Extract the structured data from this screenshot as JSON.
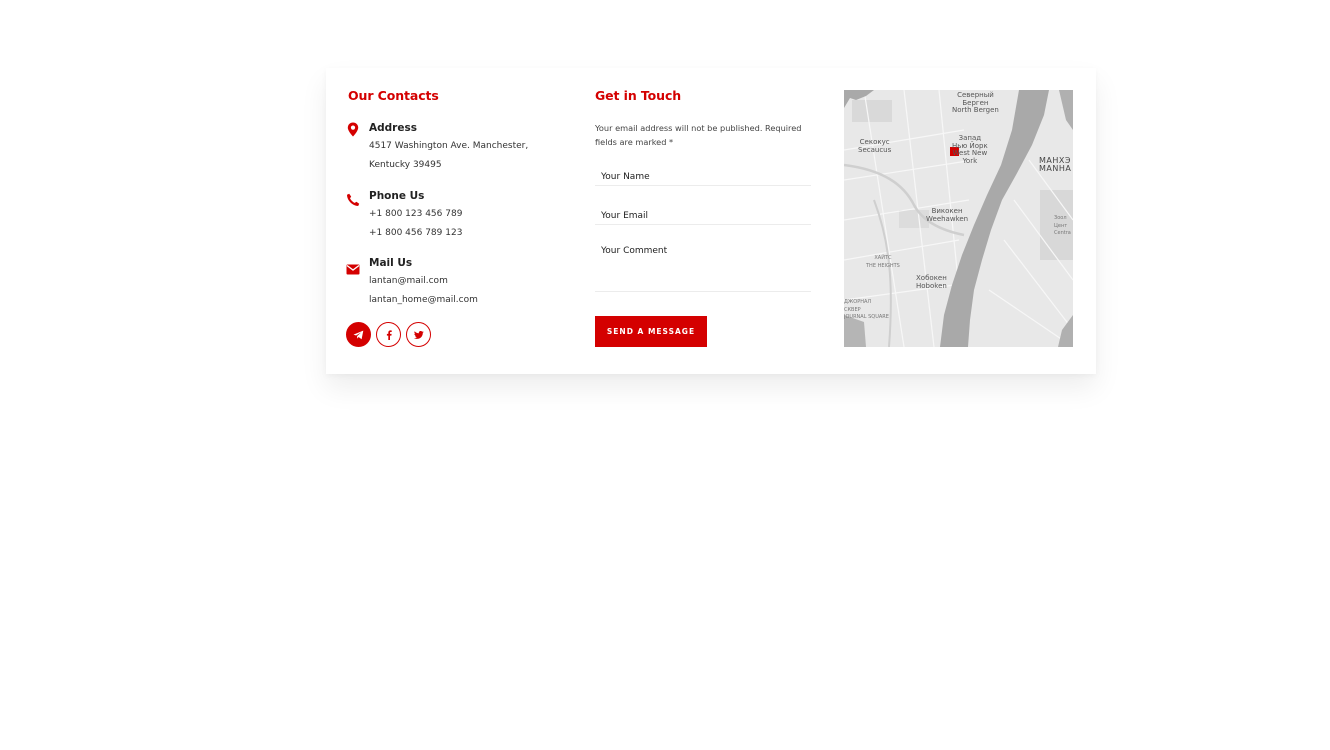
{
  "contacts": {
    "title": "Our Contacts",
    "address": {
      "heading": "Address",
      "lines": [
        "4517 Washington Ave. Manchester,",
        "Kentucky 39495"
      ],
      "icon": "map-pin-icon"
    },
    "phone": {
      "heading": "Phone Us",
      "lines": [
        "+1 800 123 456 789",
        "+1 800 456 789 123"
      ],
      "icon": "phone-icon"
    },
    "mail": {
      "heading": "Mail Us",
      "lines": [
        "lantan@mail.com",
        "lantan_home@mail.com"
      ],
      "icon": "envelope-icon"
    },
    "socials": [
      "telegram-icon",
      "facebook-icon",
      "twitter-icon"
    ]
  },
  "form": {
    "title": "Get in Touch",
    "note": "Your email address will not be published. Required fields are marked *",
    "name_placeholder": "Your Name",
    "email_placeholder": "Your Email",
    "comment_placeholder": "Your Comment",
    "submit_label": "SEND A MESSAGE"
  },
  "map": {
    "labels": {
      "north_bergen": "Северный\nБерген\nNorth Bergen",
      "secaucus": "Секокус\nSecaucus",
      "west_new_york": "Запад\nНью Йорк\nWest New\nYork",
      "manhattan": "МАНХЭ\nMANHA",
      "weehawken": "Викокен\nWeehawken",
      "heights": "ХАЙТС\nTHE HEIGHTS",
      "hoboken": "Хобокен\nHoboken",
      "journal_square": "ДЖОРНАЛ\nСКВЕР\nJOURNAL SQUARE",
      "zoo": "Зоол\nЦент\nCentra"
    },
    "colors": {
      "land": "#e8e8e8",
      "water": "#a9a9a9",
      "park": "#d6d6d6",
      "marker": "#d40000"
    }
  },
  "colors": {
    "accent": "#d40000"
  }
}
